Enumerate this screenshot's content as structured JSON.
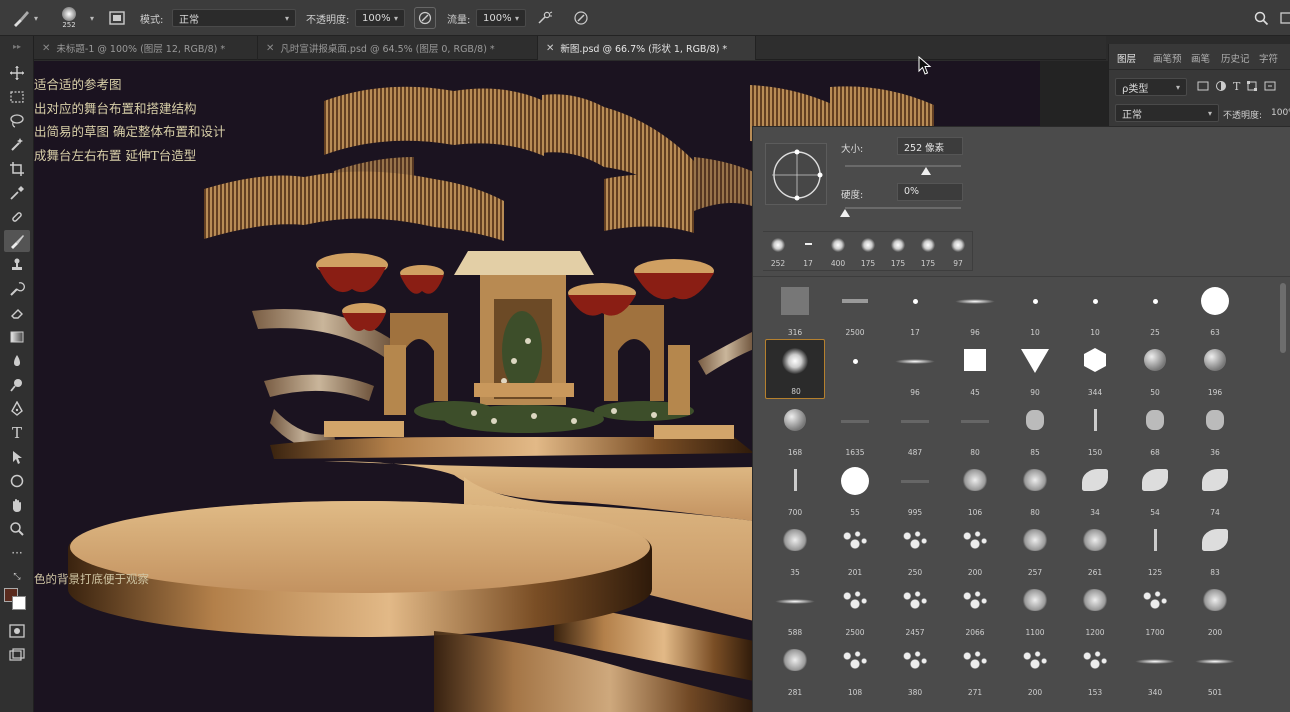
{
  "options_bar": {
    "brush_size_label": "252",
    "mode_label": "模式:",
    "mode_value": "正常",
    "opacity_label": "不透明度:",
    "opacity_value": "100%",
    "flow_label": "流量:",
    "flow_value": "100%"
  },
  "tabs": [
    {
      "label": "未标题-1 @ 100% (图层 12, RGB/8) *",
      "active": false
    },
    {
      "label": "凡时宣讲报桌面.psd @ 64.5% (图层 0, RGB/8) *",
      "active": false
    },
    {
      "label": "新图.psd @ 66.7% (形状 1, RGB/8) *",
      "active": true
    }
  ],
  "right_panel": {
    "tabs": [
      "图层",
      "画笔预",
      "画笔",
      "历史记",
      "字符"
    ],
    "filter_label": "ρ类型",
    "blend_mode": "正常",
    "opacity_label": "不透明度:",
    "opacity_value": "100%"
  },
  "canvas": {
    "caption_lines": [
      "适合适的参考图",
      "出对应的舞台布置和搭建结构",
      "出简易的草图 确定整体布置和设计",
      "成舞台左右布置 延伸T台造型"
    ],
    "bottom_caption": "色的背景打底便于观察"
  },
  "brush_popover": {
    "size_label": "大小:",
    "size_value": "252 像素",
    "size_fraction": 0.7,
    "hardness_label": "硬度:",
    "hardness_value": "0%",
    "hardness_fraction": 0.0,
    "recent_presets": [
      "252",
      "17",
      "400",
      "175",
      "175",
      "175",
      "97"
    ],
    "presets": [
      [
        "316",
        "2500",
        "17",
        "96",
        "10",
        "10",
        "25",
        "63"
      ],
      [
        "80",
        "",
        "96",
        "45",
        "90",
        "344",
        "50",
        "196"
      ],
      [
        "168",
        "1635",
        "487",
        "80",
        "85",
        "150",
        "68",
        "36"
      ],
      [
        "700",
        "55",
        "995",
        "106",
        "80",
        "34",
        "54",
        "74"
      ],
      [
        "35",
        "201",
        "250",
        "200",
        "257",
        "261",
        "125",
        "83"
      ],
      [
        "588",
        "2500",
        "2457",
        "2066",
        "1100",
        "1200",
        "1700",
        "200"
      ],
      [
        "281",
        "108",
        "380",
        "271",
        "200",
        "153",
        "340",
        "501"
      ]
    ]
  },
  "colors": {
    "bg": "#1b1320",
    "panel": "#4b4b4b",
    "accent": "#b5802e",
    "gold": "#c99a5c"
  }
}
